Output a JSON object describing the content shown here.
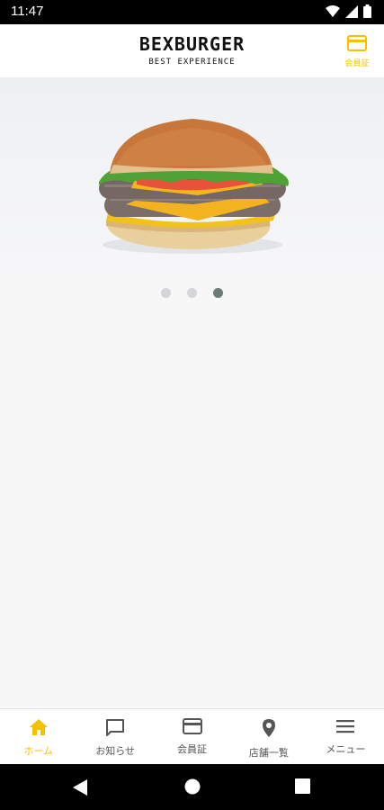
{
  "status_bar": {
    "time": "11:47",
    "icons": [
      "wifi-icon",
      "signal-icon",
      "battery-icon"
    ]
  },
  "header": {
    "title": "BEXBURGER",
    "subtitle": "BEST EXPERIENCE",
    "member_card": {
      "label": "会員証",
      "icon": "card-icon"
    }
  },
  "carousel": {
    "slide_count": 3,
    "active_index": 2
  },
  "bottom_nav": {
    "items": [
      {
        "label": "ホーム",
        "icon": "home-icon",
        "active": true
      },
      {
        "label": "お知らせ",
        "icon": "chat-icon",
        "active": false
      },
      {
        "label": "会員証",
        "icon": "card-icon",
        "active": false
      },
      {
        "label": "店舗一覧",
        "icon": "location-pin-icon",
        "active": false
      },
      {
        "label": "メニュー",
        "icon": "menu-icon",
        "active": false
      }
    ]
  },
  "colors": {
    "accent": "#f2c200",
    "inactive": "#555555",
    "dot": "#d3d5d8",
    "dot_active": "#6d7a78"
  }
}
